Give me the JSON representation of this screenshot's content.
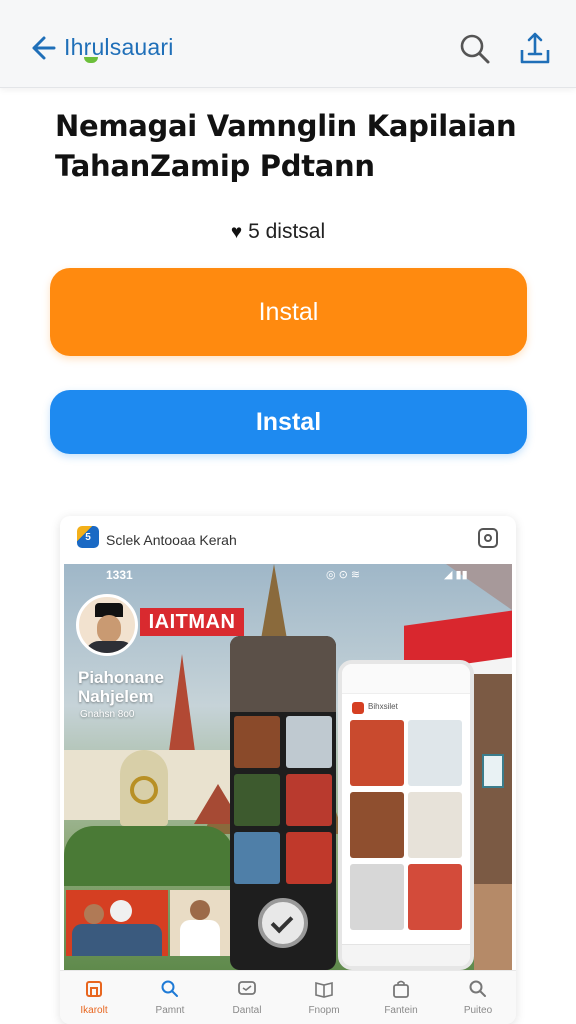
{
  "header": {
    "brand": "Ihrulsauari"
  },
  "app": {
    "title": "Nemagai Vamnglin Kapilaian TahanZamip Pdtann",
    "rating_text": "5 distsal"
  },
  "buttons": {
    "primary": "Instal",
    "secondary": "Instal"
  },
  "preview": {
    "app_icon_text": "5",
    "card_title": "Sclek Antooaa Kerah",
    "status_time": "1331",
    "status_icons": "◎ ⊙ ≋",
    "status_icons_right": "◢ ▮▮",
    "banner": "IAITMAN",
    "promo_line1": "Piahonane",
    "promo_line2": "Nahjelem",
    "promo_caption": "Gnahsn 8o0",
    "inner_label": "Bihxsilet"
  },
  "tabbar": {
    "tabs": [
      {
        "label": "Ikarolt",
        "active": true
      },
      {
        "label": "Pamnt",
        "active": false
      },
      {
        "label": "Dantal",
        "active": false
      },
      {
        "label": "Fnopm",
        "active": false
      },
      {
        "label": "Fantein",
        "active": false
      },
      {
        "label": "Puiteo",
        "active": false
      }
    ]
  },
  "colors": {
    "accent_orange": "#ff8a0f",
    "accent_blue": "#1e8af0",
    "brand_blue": "#1f6fb8"
  },
  "icons": {
    "back": "arrow-left-icon",
    "search": "search-icon",
    "share": "share-icon",
    "rating": "heart-icon",
    "screenshot": "camera-icon"
  }
}
